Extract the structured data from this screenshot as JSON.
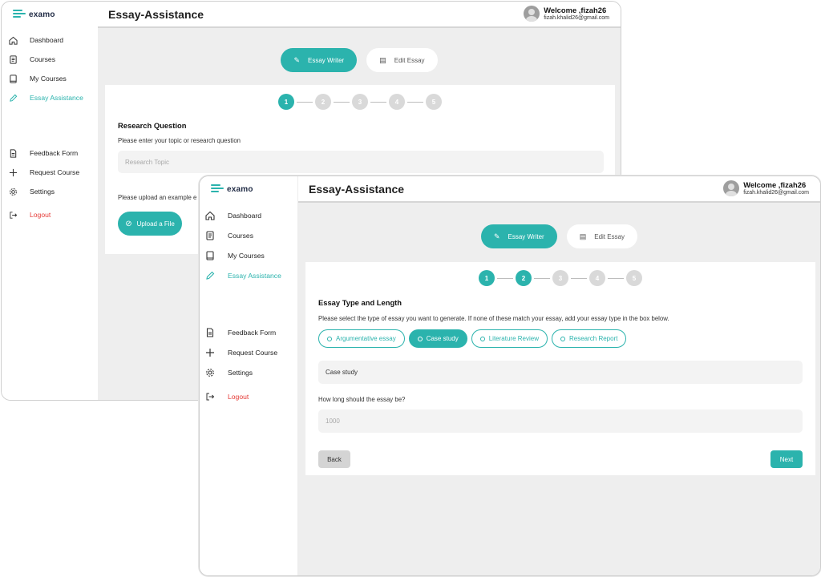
{
  "brand": {
    "name": "examo",
    "color": "#2bb3ad"
  },
  "user": {
    "welcome": "Welcome ,fizah26",
    "email": "fizah.khalid26@gmail.com"
  },
  "page_title": "Essay-Assistance",
  "sidebar": {
    "items": [
      {
        "label": "Dashboard",
        "icon": "home-icon"
      },
      {
        "label": "Courses",
        "icon": "document-icon"
      },
      {
        "label": "My Courses",
        "icon": "book-icon"
      },
      {
        "label": "Essay Assistance",
        "icon": "pencil-icon"
      },
      {
        "label": "Feedback Form",
        "icon": "form-icon"
      },
      {
        "label": "Request Course",
        "icon": "plus-icon"
      },
      {
        "label": "Settings",
        "icon": "gear-icon"
      },
      {
        "label": "Logout",
        "icon": "logout-icon"
      }
    ]
  },
  "modes": {
    "writer": "Essay Writer",
    "edit": "Edit Essay"
  },
  "steps": [
    "1",
    "2",
    "3",
    "4",
    "5"
  ],
  "back_window": {
    "active_step": 1,
    "section_title": "Research Question",
    "prompt": "Please enter your topic or research question",
    "topic_placeholder": "Research Topic",
    "upload_prompt": "Please upload an example e",
    "upload_label": "Upload a File"
  },
  "front_window": {
    "active_step": 2,
    "section_title": "Essay Type and Length",
    "prompt": "Please select the type of essay you want to generate. If none of these match your essay, add your essay type in the box below.",
    "essay_types": [
      "Argumentative essay",
      "Case study",
      "Literature Review",
      "Research Report"
    ],
    "selected_type": "Case study",
    "type_value": "Case study",
    "length_question": "How long should the essay be?",
    "length_placeholder": "1000",
    "back_label": "Back",
    "next_label": "Next"
  }
}
